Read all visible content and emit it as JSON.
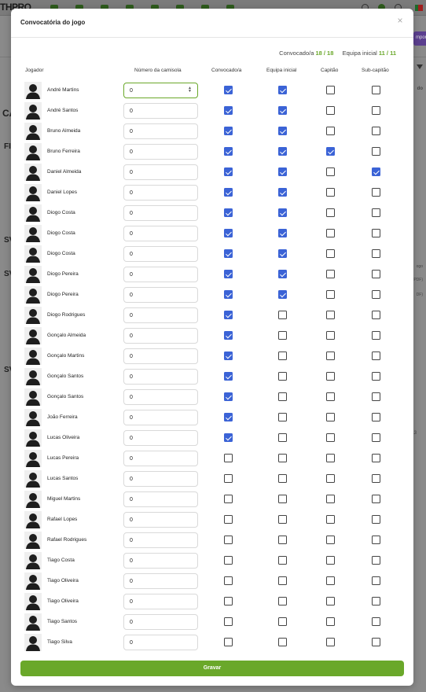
{
  "background": {
    "logo": "THPRO",
    "side_labels": [
      "CA",
      "FI",
      "SV",
      "SV",
      "SV"
    ],
    "right_button": "mpor",
    "right_text": "do",
    "right_frag_1": "ogo",
    "right_frag_2": "PDF)",
    "right_frag_3": "DF)",
    "page_num": "13"
  },
  "modal": {
    "title": "Convocatória do jogo",
    "close_label": "×",
    "summary": {
      "called_label": "Convocado/a",
      "called_value": "18 / 18",
      "starting_label": "Equipa inicial",
      "starting_value": "11 / 11"
    },
    "columns": {
      "player": "Jogador",
      "shirt": "Número da camisola",
      "called": "Convocado/a",
      "starting": "Equipa inicial",
      "captain": "Capitão",
      "vice": "Sub-capitão"
    },
    "save_label": "Gravar"
  },
  "players": [
    {
      "name": "André Martins",
      "shirt": "0",
      "called": true,
      "starting": true,
      "captain": false,
      "vice": false
    },
    {
      "name": "André Santos",
      "shirt": "0",
      "called": true,
      "starting": true,
      "captain": false,
      "vice": false
    },
    {
      "name": "Bruno Almeida",
      "shirt": "0",
      "called": true,
      "starting": true,
      "captain": false,
      "vice": false
    },
    {
      "name": "Bruno Ferreira",
      "shirt": "0",
      "called": true,
      "starting": true,
      "captain": true,
      "vice": false
    },
    {
      "name": "Daniel Almeida",
      "shirt": "0",
      "called": true,
      "starting": true,
      "captain": false,
      "vice": true
    },
    {
      "name": "Daniel Lopes",
      "shirt": "0",
      "called": true,
      "starting": true,
      "captain": false,
      "vice": false
    },
    {
      "name": "Diogo Costa",
      "shirt": "0",
      "called": true,
      "starting": true,
      "captain": false,
      "vice": false
    },
    {
      "name": "Diogo Costa",
      "shirt": "0",
      "called": true,
      "starting": true,
      "captain": false,
      "vice": false
    },
    {
      "name": "Diogo Costa",
      "shirt": "0",
      "called": true,
      "starting": true,
      "captain": false,
      "vice": false
    },
    {
      "name": "Diogo Pereira",
      "shirt": "0",
      "called": true,
      "starting": true,
      "captain": false,
      "vice": false
    },
    {
      "name": "Diogo Pereira",
      "shirt": "0",
      "called": true,
      "starting": true,
      "captain": false,
      "vice": false
    },
    {
      "name": "Diogo Rodrigues",
      "shirt": "0",
      "called": true,
      "starting": false,
      "captain": false,
      "vice": false
    },
    {
      "name": "Gonçalo Almeida",
      "shirt": "0",
      "called": true,
      "starting": false,
      "captain": false,
      "vice": false
    },
    {
      "name": "Gonçalo Martins",
      "shirt": "0",
      "called": true,
      "starting": false,
      "captain": false,
      "vice": false
    },
    {
      "name": "Gonçalo Santos",
      "shirt": "0",
      "called": true,
      "starting": false,
      "captain": false,
      "vice": false
    },
    {
      "name": "Gonçalo Santos",
      "shirt": "0",
      "called": true,
      "starting": false,
      "captain": false,
      "vice": false
    },
    {
      "name": "João Ferreira",
      "shirt": "0",
      "called": true,
      "starting": false,
      "captain": false,
      "vice": false
    },
    {
      "name": "Lucas Oliveira",
      "shirt": "0",
      "called": true,
      "starting": false,
      "captain": false,
      "vice": false
    },
    {
      "name": "Lucas Pereira",
      "shirt": "0",
      "called": false,
      "starting": false,
      "captain": false,
      "vice": false
    },
    {
      "name": "Lucas Santos",
      "shirt": "0",
      "called": false,
      "starting": false,
      "captain": false,
      "vice": false
    },
    {
      "name": "Miguel Martins",
      "shirt": "0",
      "called": false,
      "starting": false,
      "captain": false,
      "vice": false
    },
    {
      "name": "Rafael Lopes",
      "shirt": "0",
      "called": false,
      "starting": false,
      "captain": false,
      "vice": false
    },
    {
      "name": "Rafael Rodrigues",
      "shirt": "0",
      "called": false,
      "starting": false,
      "captain": false,
      "vice": false
    },
    {
      "name": "Tiago Costa",
      "shirt": "0",
      "called": false,
      "starting": false,
      "captain": false,
      "vice": false
    },
    {
      "name": "Tiago Oliveira",
      "shirt": "0",
      "called": false,
      "starting": false,
      "captain": false,
      "vice": false
    },
    {
      "name": "Tiago Oliveira",
      "shirt": "0",
      "called": false,
      "starting": false,
      "captain": false,
      "vice": false
    },
    {
      "name": "Tiago Santos",
      "shirt": "0",
      "called": false,
      "starting": false,
      "captain": false,
      "vice": false
    },
    {
      "name": "Tiago Silva",
      "shirt": "0",
      "called": false,
      "starting": false,
      "captain": false,
      "vice": false
    }
  ],
  "colors": {
    "accent_green": "#6aa82a",
    "checkbox_blue": "#3b63d6"
  }
}
